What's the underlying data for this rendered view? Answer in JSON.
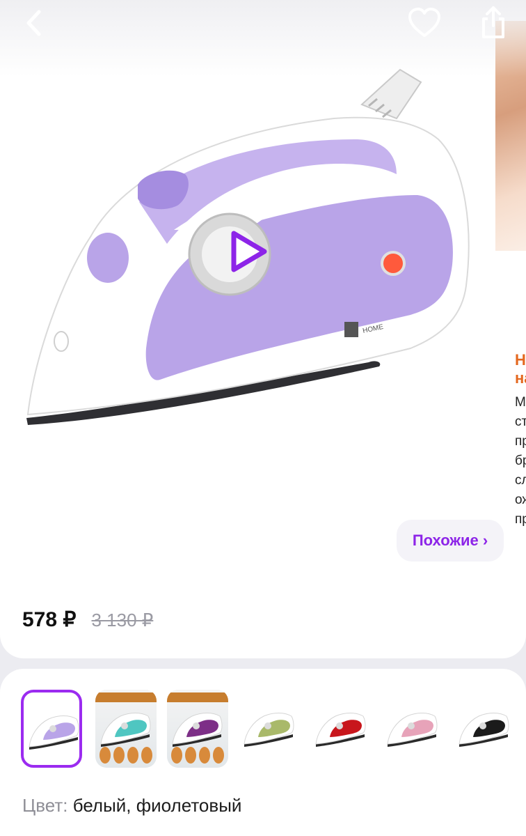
{
  "header": {
    "back_icon": "chevron-left-icon",
    "favorite_icon": "heart-icon",
    "share_icon": "share-icon"
  },
  "gallery": {
    "play_icon": "play-icon",
    "next_slide_title": "На\nна",
    "next_slide_text": "М\nст\nпр\nбр\nсл\nож\nпр"
  },
  "similar_button": {
    "label": "Похожие ›"
  },
  "price": {
    "current": "578 ₽",
    "old": "3 130 ₽"
  },
  "variants": {
    "selected_index": 0,
    "items": [
      {
        "color": "#b9a4e8",
        "kind": "plain"
      },
      {
        "color": "#4fc6c1",
        "kind": "promo"
      },
      {
        "color": "#7d2f87",
        "kind": "promo"
      },
      {
        "color": "#a9b96a",
        "kind": "plain"
      },
      {
        "color": "#c8161c",
        "kind": "plain"
      },
      {
        "color": "#e7a3b9",
        "kind": "plain"
      },
      {
        "color": "#1b1b1b",
        "kind": "plain"
      }
    ]
  },
  "color": {
    "label": "Цвет:",
    "value": "белый, фиолетовый"
  },
  "colors": {
    "accent": "#8d24e8",
    "selected_border": "#9b2bf0",
    "next_title": "#e4681f"
  }
}
